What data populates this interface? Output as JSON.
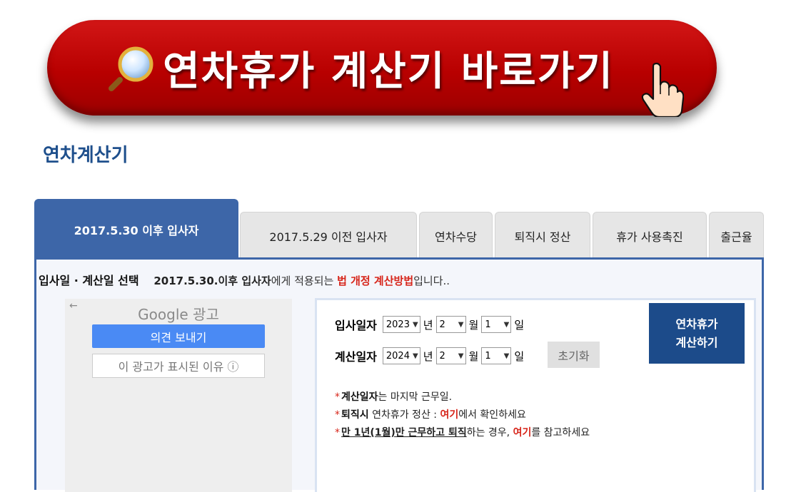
{
  "banner": {
    "text": "연차휴가 계산기 바로가기",
    "icon": "magnifier-icon",
    "pointer": "hand-pointer-icon",
    "color": "#c10a0a"
  },
  "page_title": "연차계산기",
  "tabs": [
    "2017.5.30 이후 입사자",
    "2017.5.29 이전 입사자",
    "연차수당",
    "퇴직시 정산",
    "휴가 사용촉진",
    "출근율"
  ],
  "active_tab": 0,
  "panel": {
    "heading": "입사일 · 계산일 선택",
    "note_prefix": "2017.5.30.이후 입사자",
    "note_mid": "에게 적용되는 ",
    "note_red": "법 개정 계산방법",
    "note_suffix": "입니다.."
  },
  "ad": {
    "back": "←",
    "brand": "Google 광고",
    "feedback": "의견 보내기",
    "why": "이 광고가 표시된 이유 ⓘ"
  },
  "calc": {
    "hire": {
      "label": "입사일자",
      "year": "2023",
      "month": "2",
      "day": "1"
    },
    "calc": {
      "label": "계산일자",
      "year": "2024",
      "month": "2",
      "day": "1"
    },
    "year_unit": "년",
    "month_unit": "월",
    "day_unit": "일",
    "reset": "초기화",
    "go_line1": "연차휴가",
    "go_line2": "계산하기",
    "note1_bold": "계산일자",
    "note1_rest": "는 마지막 근무일.",
    "note2_bold": "퇴직시",
    "note2_mid": " 연차휴가 정산 : ",
    "note2_link": "여기",
    "note2_rest": "에서 확인하세요",
    "note3_u": "만 1년(1월)만 근무하고 퇴직",
    "note3_mid": "하는 경우, ",
    "note3_link": "여기",
    "note3_rest": "를 참고하세요",
    "asterisk": "*"
  }
}
